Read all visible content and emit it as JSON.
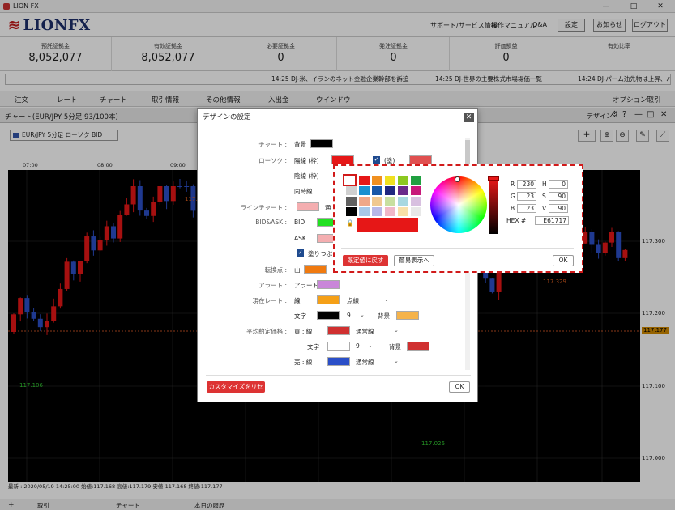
{
  "window": {
    "title": "LION FX",
    "min": "—",
    "max": "□",
    "close": "✕"
  },
  "header": {
    "logo": "LIONFX",
    "links": [
      "サポート/サービス情報",
      "操作マニュアル",
      "Q&A"
    ],
    "buttons": [
      "設定",
      "お知らせ",
      "ログアウト"
    ]
  },
  "account": [
    {
      "label": "預託証拠金",
      "value": "8,052,077"
    },
    {
      "label": "有効証拠金",
      "value": "8,052,077"
    },
    {
      "label": "必要証拠金",
      "value": "0"
    },
    {
      "label": "発注証拠金",
      "value": "0"
    },
    {
      "label": "評価損益",
      "value": "0"
    },
    {
      "label": "有効比率",
      "value": ""
    }
  ],
  "ticker": [
    "14:25  DJ-米、イランのネット金融企業幹部を訴追",
    "14:25  DJ-世界の主要株式市場場価一覧",
    "14:24  DJ-パーム油先物は上昇、バイア"
  ],
  "menu": [
    "注文",
    "レート",
    "チャート",
    "取引情報",
    "その他情報",
    "入出金",
    "ウインドウ",
    "オプション取引"
  ],
  "chart_header": {
    "title": "チャート(EUR/JPY 5分足 93/100本)",
    "design": "デザイン"
  },
  "symbol": "EUR/JPY 5分足 ローソク BID",
  "time_ticks": [
    "07:00",
    "08:00",
    "09:00"
  ],
  "price_ticks": [
    "117.300",
    "117.200",
    "117.177",
    "117.100",
    "117.000"
  ],
  "chart_labels": {
    "high": "117.329",
    "low": "117.026",
    "hi_left": "117.400",
    "lo_left": "117.106"
  },
  "footer": "最新 : 2020/05/19 14:25:00 始値:117.168 高値:117.179 安値:117.168 終値:117.177",
  "bottom_tabs": [
    "取引",
    "チャート",
    "本日の履歴"
  ],
  "dialog": {
    "title": "デザインの設定",
    "rows": {
      "chart": "チャート :",
      "bg": "背景",
      "candle": "ローソク :",
      "yang": "陽線 (枠)",
      "fill": "(塗)",
      "yin": "陰線 (枠)",
      "doji": "同時線",
      "line": "ラインチャート :",
      "line_sub": "通",
      "bidask": "BID&ASK :",
      "bid": "BID",
      "ask": "ASK",
      "fill_check": "塗りつぶ",
      "turn": "転換点 :",
      "mountain": "山",
      "alert": "アラート :",
      "alert_sub": "アラート",
      "cur": "現在レート :",
      "cur_line": "線",
      "dotted": "点線",
      "text": "文字",
      "nine": "9",
      "bgc": "背景",
      "avg": "平均約定価格 :",
      "buy_line": "買 : 線",
      "normal": "通常線",
      "text2": "文字",
      "nine2": "9",
      "bgc2": "背景",
      "sell_line": "売 : 線",
      "normal2": "通常線"
    },
    "reset": "カスタマイズをリセット",
    "ok": "OK"
  },
  "picker": {
    "reset": "既定値に戻す",
    "simple": "簡易表示へ",
    "ok": "OK",
    "r": "230",
    "g": "23",
    "b": "23",
    "h": "0",
    "s": "90",
    "v": "90",
    "hex": "E61717",
    "hex_label": "HEX #",
    "R": "R",
    "G": "G",
    "B": "B",
    "H": "H",
    "S": "S",
    "V": "V"
  },
  "colors": {
    "selected": "#e61717",
    "accent": "#d11a1a"
  }
}
